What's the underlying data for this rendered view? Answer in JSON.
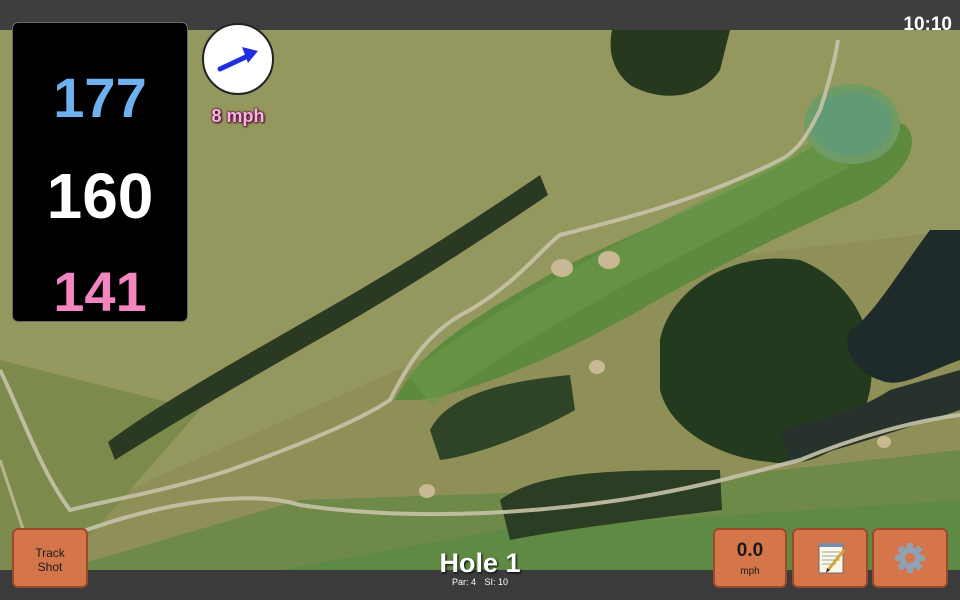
{
  "status": {
    "time": "10:10"
  },
  "distances": {
    "back": "177",
    "center": "160",
    "front": "141"
  },
  "wind": {
    "speed_label": "8 mph",
    "direction": "east-northeast"
  },
  "hole": {
    "title": "Hole 1",
    "par": "Par: 4",
    "stroke_index": "SI: 10"
  },
  "buttons": {
    "track_shot": "Track\nShot",
    "wind_value": "0.0",
    "wind_unit": "mph",
    "notes_icon": "notepad-icon",
    "settings_icon": "gear-icon"
  },
  "colors": {
    "back_distance": "#6fb1ef",
    "center_distance": "#ffffff",
    "front_distance": "#f386c0",
    "button_fill": "#d4764a",
    "wind_arrow": "#1f2fe0"
  }
}
